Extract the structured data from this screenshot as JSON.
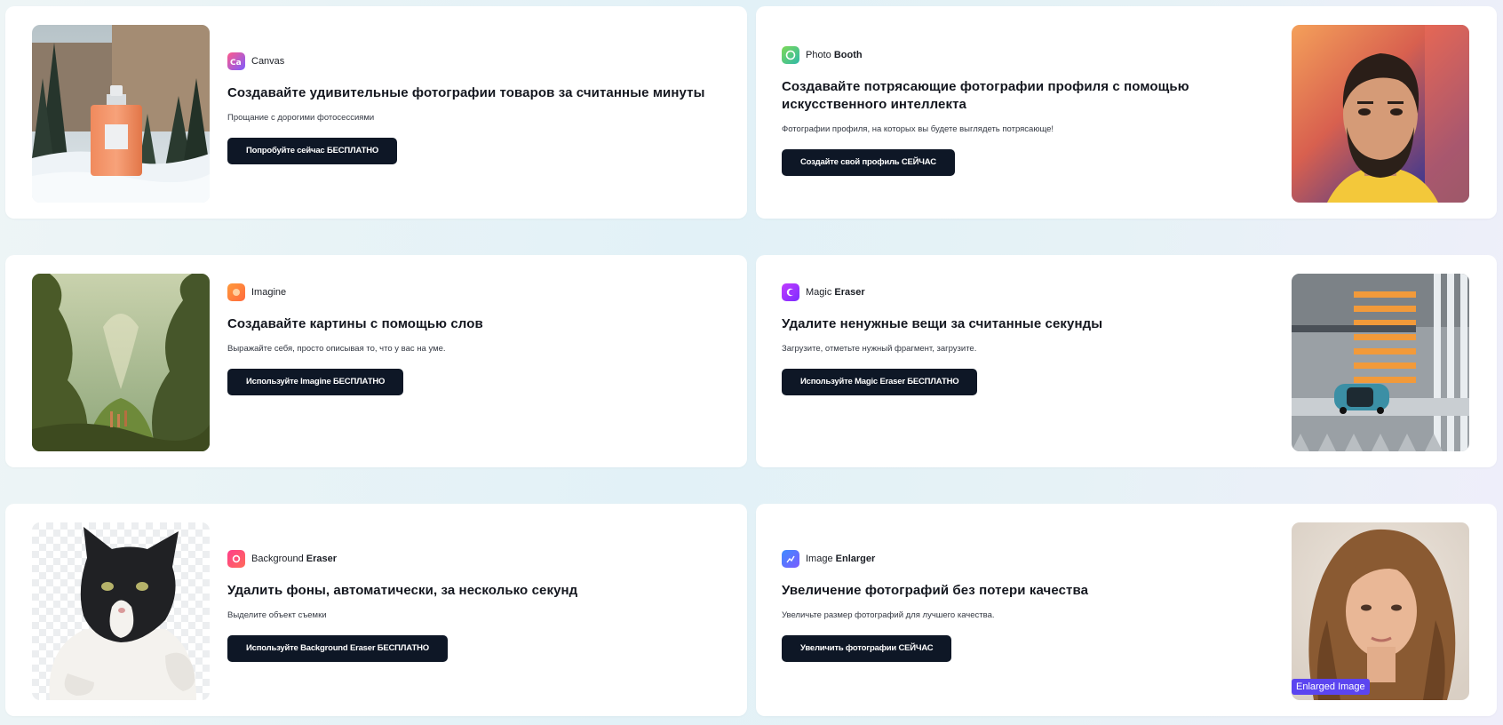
{
  "cards": [
    {
      "brand_name": "Canvas",
      "brand_bold": "",
      "title": "Создавайте удивительные фотографии товаров за считанные минуты",
      "subtitle": "Прощание с дорогими фотосессиями",
      "button": "Попробуйте сейчас БЕСПЛАТНО",
      "logo_colors": [
        "#ff5a8a",
        "#7d5cff"
      ],
      "image": "perfume-bottle-in-snow"
    },
    {
      "brand_name": "Photo",
      "brand_bold": "Booth",
      "title": "Создавайте потрясающие фотографии профиля с помощью искусственного интеллекта",
      "subtitle": "Фотографии профиля, на которых вы будете выглядеть потрясающе!",
      "button": "Создайте свой профиль СЕЙЧАС",
      "logo_colors": [
        "#7ed957",
        "#2fb9a8"
      ],
      "image": "bearded-man-portrait"
    },
    {
      "brand_name": "Imagine",
      "brand_bold": "",
      "title": "Создавайте картины с помощью слов",
      "subtitle": "Выражайте себя, просто описывая то, что у вас на уме.",
      "button": "Используйте Imagine БЕСПЛАТНО",
      "logo_colors": [
        "#ff9a3c",
        "#ff6a3d"
      ],
      "image": "fantasy-valley-painting"
    },
    {
      "brand_name": "Magic",
      "brand_bold": "Eraser",
      "title": "Удалите ненужные вещи за считанные секунды",
      "subtitle": "Загрузите, отметьте нужный фрагмент, загрузите.",
      "button": "Используйте Magic Eraser БЕСПЛАТНО",
      "logo_colors": [
        "#c23cff",
        "#7b2cff"
      ],
      "image": "car-crosswalk-aerial"
    },
    {
      "brand_name": "Background",
      "brand_bold": "Eraser",
      "title": "Удалить фоны, автоматически, за несколько секунд",
      "subtitle": "Выделите объект съемки",
      "button": "Используйте Background Eraser БЕСПЛАТНО",
      "logo_colors": [
        "#ff3d8b",
        "#ff6b5a"
      ],
      "image": "cat-cutout"
    },
    {
      "brand_name": "Image",
      "brand_bold": "Enlarger",
      "title": "Увеличение фотографий без потери качества",
      "subtitle": "Увеличьте размер фотографий для лучшего качества.",
      "button": "Увеличить фотографии СЕЙЧАС",
      "logo_colors": [
        "#3d8bff",
        "#7b5cff"
      ],
      "image": "curly-haired-woman-portrait",
      "badge": "Enlarged Image"
    }
  ],
  "colors": {
    "button_bg": "#0e1726",
    "badge_bg": "#5b45f0"
  }
}
